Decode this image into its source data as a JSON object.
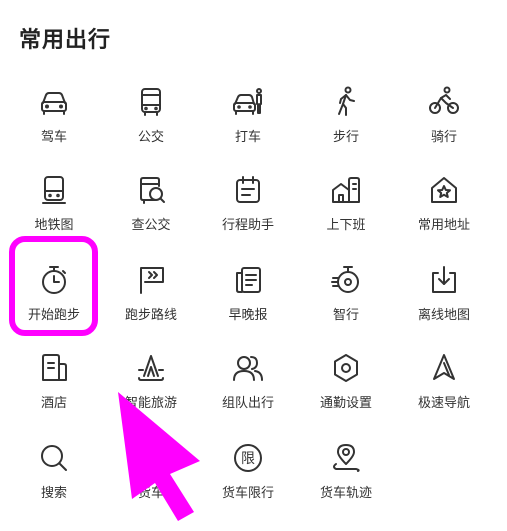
{
  "section_title": "常用出行",
  "items": [
    {
      "label": "驾车",
      "icon": "car-icon"
    },
    {
      "label": "公交",
      "icon": "bus-icon"
    },
    {
      "label": "打车",
      "icon": "taxi-icon"
    },
    {
      "label": "步行",
      "icon": "walk-icon"
    },
    {
      "label": "骑行",
      "icon": "bike-icon"
    },
    {
      "label": "地铁图",
      "icon": "subway-icon"
    },
    {
      "label": "查公交",
      "icon": "bus-search-icon"
    },
    {
      "label": "行程助手",
      "icon": "calendar-icon"
    },
    {
      "label": "上下班",
      "icon": "commute-icon"
    },
    {
      "label": "常用地址",
      "icon": "home-star-icon"
    },
    {
      "label": "开始跑步",
      "icon": "stopwatch-icon"
    },
    {
      "label": "跑步路线",
      "icon": "flag-icon"
    },
    {
      "label": "早晚报",
      "icon": "newspaper-icon"
    },
    {
      "label": "智行",
      "icon": "smart-travel-icon"
    },
    {
      "label": "离线地图",
      "icon": "download-icon"
    },
    {
      "label": "酒店",
      "icon": "hotel-icon"
    },
    {
      "label": "智能旅游",
      "icon": "mountain-icon"
    },
    {
      "label": "组队出行",
      "icon": "group-icon"
    },
    {
      "label": "通勤设置",
      "icon": "hexagon-settings-icon"
    },
    {
      "label": "极速导航",
      "icon": "navigation-arrow-icon"
    },
    {
      "label": "搜索",
      "icon": "search-icon"
    },
    {
      "label": "货车",
      "icon": "truck-icon"
    },
    {
      "label": "货车限行",
      "icon": "restriction-icon"
    },
    {
      "label": "货车轨迹",
      "icon": "track-icon"
    }
  ],
  "highlight": {
    "color": "#ff00ff",
    "target": "开始跑步"
  },
  "cursor": {
    "icon": "pointer-arrow-icon",
    "color": "#ff00ff"
  }
}
